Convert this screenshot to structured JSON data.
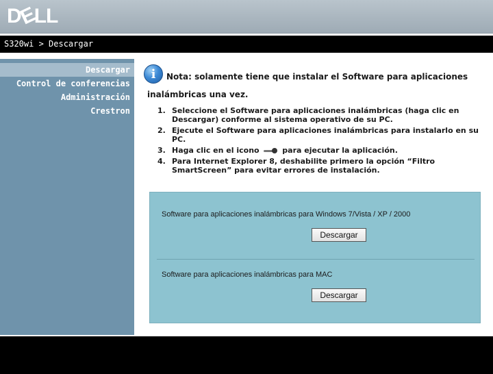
{
  "header": {
    "logo_text": "DELL",
    "logo_left": "D",
    "logo_e": "E",
    "logo_right": "LL"
  },
  "titlebar": {
    "text": "S320wi > Descargar"
  },
  "sidebar": {
    "items": [
      {
        "label": "Descargar",
        "active": true
      },
      {
        "label": "Control de conferencias",
        "active": false
      },
      {
        "label": "Administración",
        "active": false
      },
      {
        "label": "Crestron",
        "active": false
      }
    ]
  },
  "note": {
    "icon": "info-icon",
    "line1": "Nota: solamente tiene que instalar el Software para aplicaciones",
    "line2": "inalámbricas una vez."
  },
  "steps": [
    {
      "num": "1.",
      "text": "Seleccione el Software para aplicaciones inalámbricas (haga clic en Descargar) conforme al sistema operativo de su PC."
    },
    {
      "num": "2.",
      "text": "Ejecute el Software para aplicaciones inalámbricas para instalarlo en su PC."
    },
    {
      "num": "3.",
      "text_before": "Haga clic en el icono",
      "text_after": "para ejecutar la aplicación.",
      "icon": "toggle-icon"
    },
    {
      "num": "4.",
      "text": "Para Internet Explorer 8, deshabilite primero la opción  “Filtro SmartScreen”  para evitar errores de instalación."
    }
  ],
  "downloads": [
    {
      "label": "Software para aplicaciones inalámbricas para Windows 7/Vista / XP / 2000",
      "button": "Descargar"
    },
    {
      "label": "Software para aplicaciones inalámbricas para MAC",
      "button": "Descargar"
    }
  ]
}
